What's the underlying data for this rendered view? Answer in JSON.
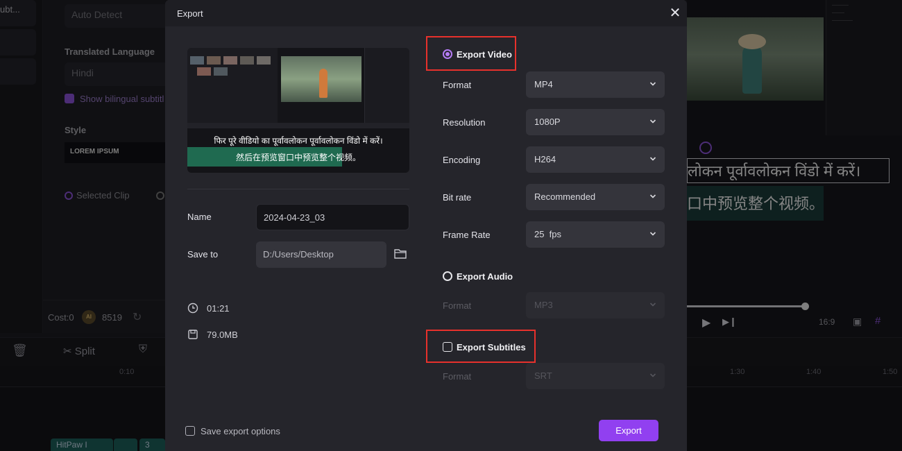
{
  "background": {
    "left_tab_text": "ubt...",
    "source_language_value": "Auto Detect",
    "translated_language_label": "Translated Language",
    "translated_language_value": "Hindi",
    "bilingual_checkbox_label": "Show bilingual subtitl",
    "style_label": "Style",
    "style_preset": "LOREM IPSUM",
    "selected_clip_label": "Selected Clip",
    "cost_label": "Cost:0",
    "ai_badge": "AI",
    "credits": "8519",
    "split_label": "Split",
    "ruler_ticks": [
      "0:10",
      "1:30",
      "1:40",
      "1:50"
    ],
    "track_clip_label": "HitPaw I",
    "track_clip_label_2": "3",
    "subtitle_hindi": "लोकन पूर्वावलोकन विंडो में करें।",
    "subtitle_chinese": "口中预览整个视频。",
    "aspect_ratio": "16:9"
  },
  "dialog": {
    "title": "Export",
    "preview": {
      "subtitle_line1": "फिर पूरे वीडियो का पूर्वावलोकन पूर्वावलोकन विंडो में करें।",
      "subtitle_line2": "然后在预览窗口中预览整个视频。"
    },
    "name_label": "Name",
    "name_value": "2024-04-23_03",
    "save_to_label": "Save to",
    "save_to_value": "D:/Users/Desktop",
    "duration": "01:21",
    "file_size": "79.0MB",
    "export_video": {
      "title": "Export Video",
      "selected": true,
      "format_label": "Format",
      "format_value": "MP4",
      "resolution_label": "Resolution",
      "resolution_value": "1080P",
      "encoding_label": "Encoding",
      "encoding_value": "H264",
      "bitrate_label": "Bit rate",
      "bitrate_value": "Recommended",
      "framerate_label": "Frame Rate",
      "framerate_value": "25  fps"
    },
    "export_audio": {
      "title": "Export Audio",
      "format_label": "Format",
      "format_value": "MP3"
    },
    "export_subtitles": {
      "title": "Export Subtitles",
      "format_label": "Format",
      "format_value": "SRT"
    },
    "save_options_label": "Save export options",
    "export_button": "Export",
    "colors": {
      "accent": "#9140f0",
      "highlight_box": "#e8312c"
    }
  }
}
